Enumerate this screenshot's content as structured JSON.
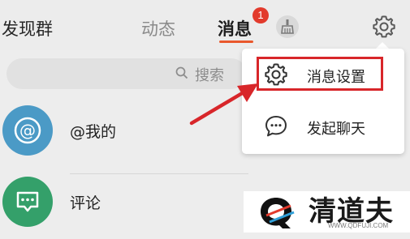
{
  "header": {
    "tabs": [
      {
        "label": "发现群"
      },
      {
        "label": "动态"
      },
      {
        "label": "消息"
      }
    ],
    "active_tab": "消息",
    "unread_badge": "1"
  },
  "search": {
    "placeholder": "搜索"
  },
  "list": {
    "items": [
      {
        "label": "@我的",
        "avatar_color": "#4b9ac6",
        "icon": "at-icon"
      },
      {
        "label": "评论",
        "avatar_color": "#34a06a",
        "icon": "comment-icon"
      }
    ]
  },
  "menu": {
    "items": [
      {
        "label": "消息设置",
        "icon": "gear-icon"
      },
      {
        "label": "发起聊天",
        "icon": "chat-bubble-icon"
      }
    ]
  },
  "watermark": {
    "title": "清道夫",
    "url": "WWW.QDFUJI.COM"
  },
  "colors": {
    "accent": "#e9582c",
    "badge": "#e23a2c",
    "annotation": "#d8262a"
  }
}
